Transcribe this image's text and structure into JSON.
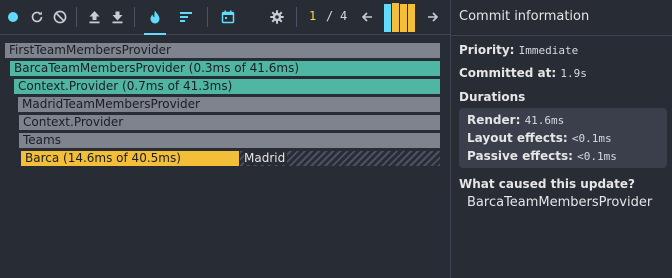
{
  "toolbar": {
    "record_icon": "record-dot-icon",
    "reload_icon": "reload-icon",
    "clear_icon": "no-entry-icon",
    "load_icon": "upload-icon",
    "save_icon": "download-icon",
    "flamegraph_icon": "flame-icon",
    "ranked_icon": "ranked-bars-icon",
    "timeline_icon": "calendar-icon",
    "settings_icon": "gear-icon",
    "commit_current": "1",
    "commit_separator": "/",
    "commit_total": "4",
    "prev_icon": "arrow-left-icon",
    "next_icon": "arrow-right-icon",
    "commit_bars": [
      {
        "level": 0.95,
        "color": "#61dafb"
      },
      {
        "level": 1.0,
        "color": "#f3bf38"
      },
      {
        "level": 0.95,
        "color": "#f3bf38"
      },
      {
        "level": 0.95,
        "color": "#f3bf38"
      }
    ]
  },
  "flamegraph": {
    "nodes": [
      {
        "label": "FirstTeamMembersProvider"
      },
      {
        "label": "BarcaTeamMembersProvider (0.3ms of 41.6ms)"
      },
      {
        "label": "Context.Provider (0.7ms of 41.3ms)"
      },
      {
        "label": "MadridTeamMembersProvider"
      },
      {
        "label": "Context.Provider"
      },
      {
        "label": "Teams"
      },
      {
        "label": "Barca (14.6ms of 40.5ms)"
      },
      {
        "label": "Madrid"
      }
    ]
  },
  "panel": {
    "title": "Commit information",
    "priority_label": "Priority:",
    "priority_value": "Immediate",
    "committed_label": "Committed at:",
    "committed_value": "1.9s",
    "durations_label": "Durations",
    "render_label": "Render:",
    "render_value": "41.6ms",
    "layout_label": "Layout effects:",
    "layout_value": "<0.1ms",
    "passive_label": "Passive effects:",
    "passive_value": "<0.1ms",
    "cause_label": "What caused this update?",
    "cause_value": "BarcaTeamMembersProvider"
  }
}
